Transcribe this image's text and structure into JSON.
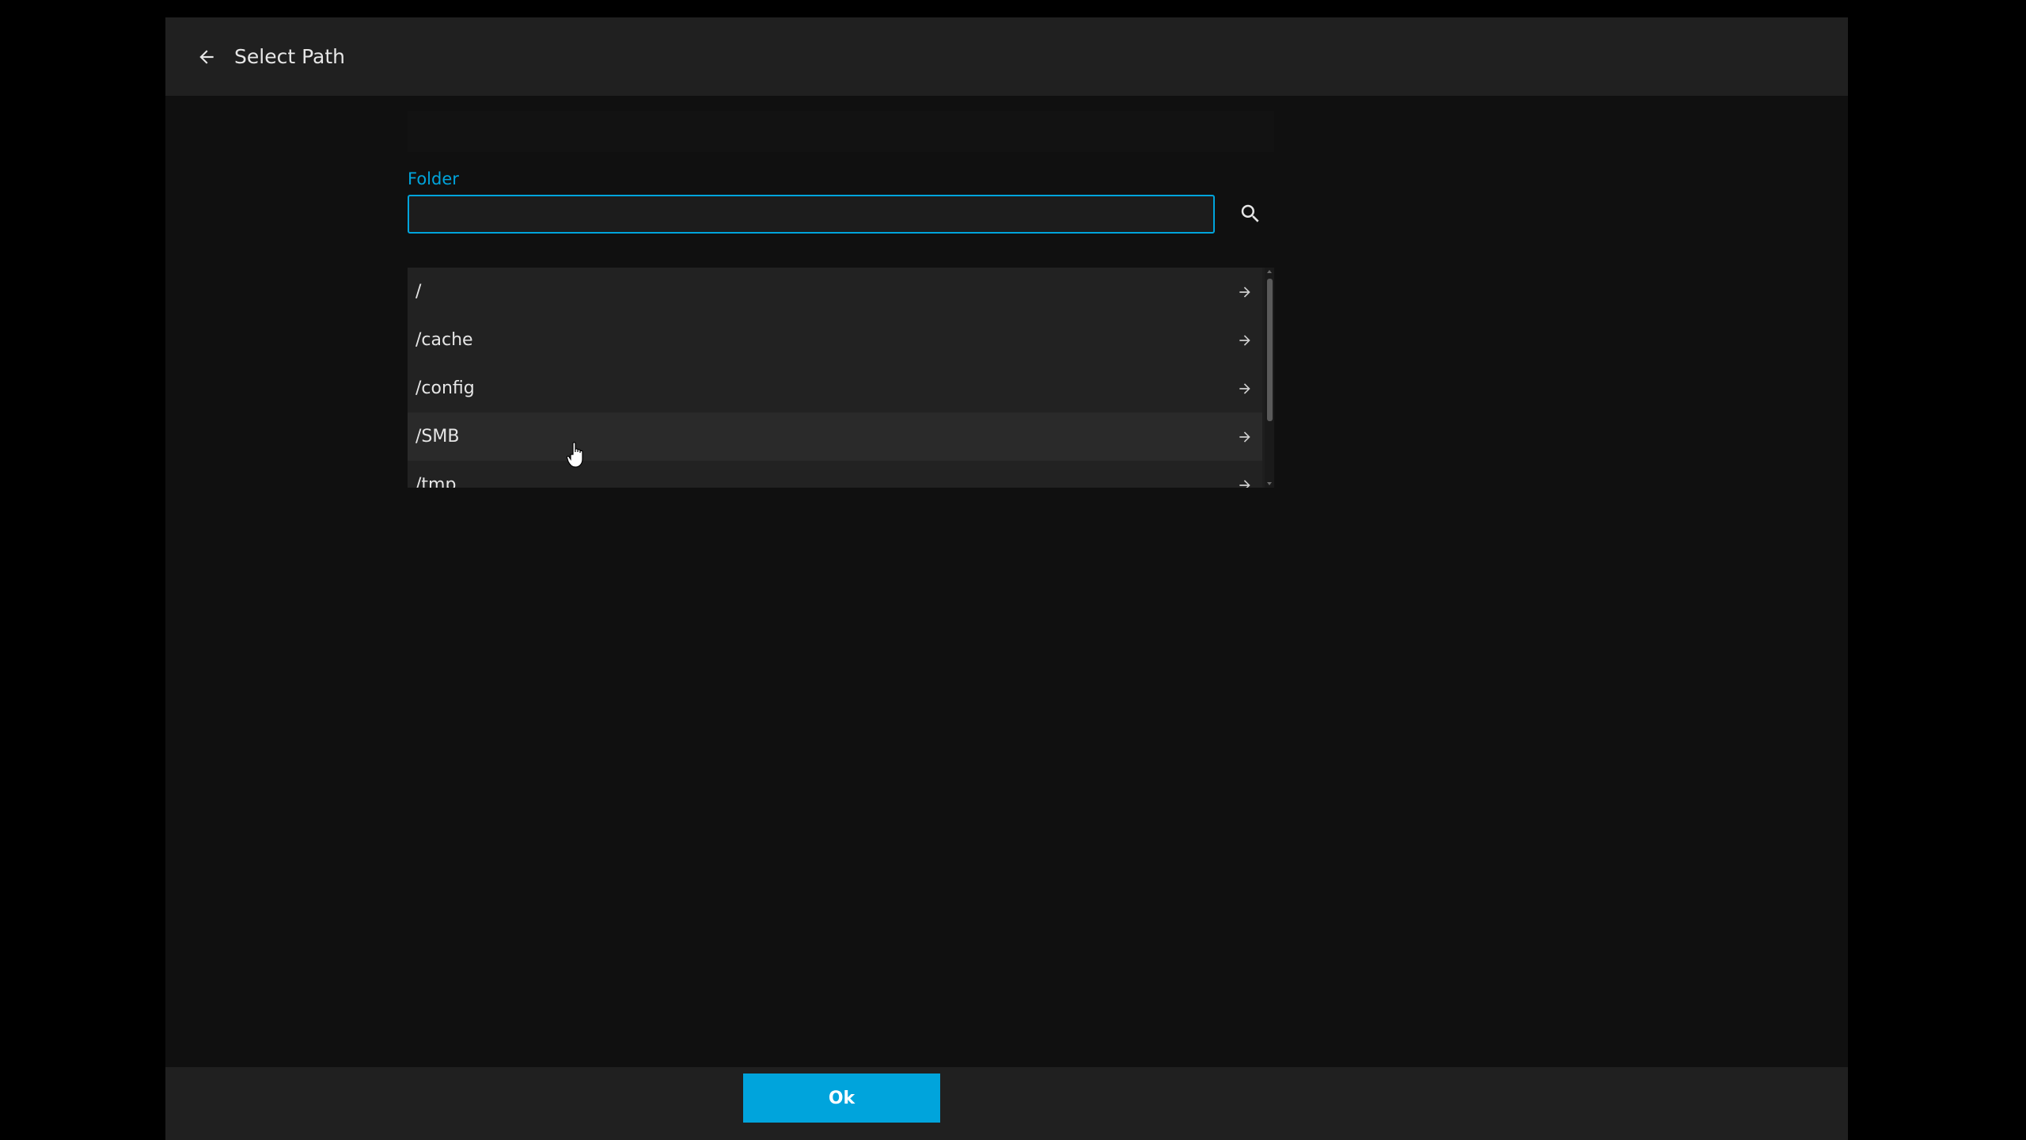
{
  "header": {
    "title": "Select Path",
    "back_icon": "arrow-left-icon"
  },
  "folder": {
    "label": "Folder",
    "value": "",
    "placeholder": "",
    "search_icon": "search-icon"
  },
  "list": {
    "items": [
      {
        "label": "/"
      },
      {
        "label": "/cache"
      },
      {
        "label": "/config"
      },
      {
        "label": "/SMB"
      },
      {
        "label": "/tmp"
      }
    ],
    "item_icon": "arrow-right-icon"
  },
  "footer": {
    "ok_label": "Ok"
  },
  "colors": {
    "accent": "#00a4dc",
    "header_bg": "#202020",
    "content_bg": "#101010"
  }
}
